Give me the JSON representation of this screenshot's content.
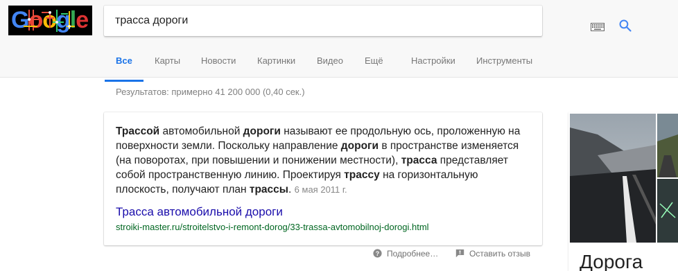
{
  "search": {
    "query": "трасса дороги"
  },
  "tabs": [
    {
      "label": "Все"
    },
    {
      "label": "Карты"
    },
    {
      "label": "Новости"
    },
    {
      "label": "Картинки"
    },
    {
      "label": "Видео"
    },
    {
      "label": "Ещё"
    },
    {
      "label": "Настройки"
    },
    {
      "label": "Инструменты"
    }
  ],
  "stats": "Результатов: примерно 41 200 000 (0,40 сек.)",
  "featured_snippet": {
    "date": "6 мая 2011 г.",
    "result_title": "Трасса автомобильной дороги",
    "result_url": "stroiki-master.ru/stroitelstvo-i-remont-dorog/33-trassa-avtomobilnoj-dorogi.html"
  },
  "snippet_text": {
    "s1": "Трассой",
    "s2": " автомобильной ",
    "s3": "дороги",
    "s4": " называют ее продольную ось, проложенную на поверхности земли. Поскольку направление ",
    "s5": "дороги",
    "s6": " в пространстве изменяется (на поворотах, при повышении и понижении местности), ",
    "s7": "трасса",
    "s8": " представляет собой пространственную линию. Проектируя ",
    "s9": "трассу",
    "s10": " на горизонтальную плоскость, получают план ",
    "s11": "трассы",
    "s12": ". "
  },
  "footer": {
    "more": "Подробнее…",
    "feedback": "Оставить отзыв"
  },
  "knowledge_panel": {
    "title": "Дорога"
  },
  "logo": {
    "text": "Google"
  },
  "colors": {
    "accent": "#1a73e8",
    "link": "#1a0dab",
    "url": "#006621"
  },
  "icons": {
    "keyboard": "keyboard-icon",
    "search": "search-icon",
    "help": "help-circle-icon",
    "feedback": "feedback-icon"
  }
}
